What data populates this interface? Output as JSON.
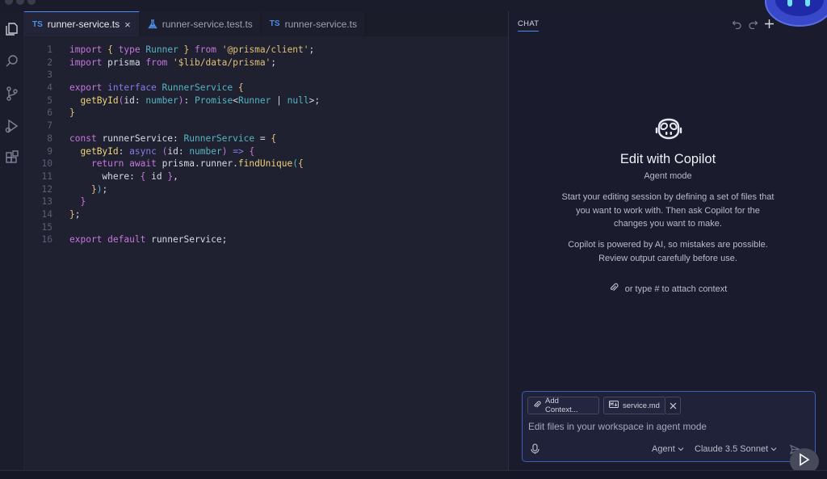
{
  "tabs": [
    {
      "lang": "TS",
      "name": "runner-service.ts",
      "active": true,
      "close": "×"
    },
    {
      "name": "runner-service.test.ts",
      "active": false
    },
    {
      "lang": "TS",
      "name": "runner-service.ts",
      "active": false
    }
  ],
  "code": {
    "line_numbers": [
      "1",
      "2",
      "3",
      "4",
      "5",
      "6",
      "7",
      "8",
      "9",
      "10",
      "11",
      "12",
      "13",
      "14",
      "15",
      "16"
    ]
  },
  "chat": {
    "tab_label": "CHAT",
    "title": "Edit with Copilot",
    "mode": "Agent mode",
    "description": "Start your editing session by defining a set of files that you want to work with. Then ask Copilot for the changes you want to make.",
    "disclaimer": "Copilot is powered by AI, so mistakes are possible. Review output carefully before use.",
    "attach_hint": "or type # to attach context",
    "input": {
      "add_context_label": "Add Context...",
      "file_chip_label": "service.md",
      "placeholder": "Edit files in your workspace in agent mode",
      "mode_dropdown": "Agent",
      "model_dropdown": "Claude 3.5 Sonnet"
    }
  },
  "icons": {
    "activity": [
      "explorer-icon",
      "search-icon",
      "source-control-icon",
      "run-debug-icon",
      "extensions-icon"
    ],
    "header": [
      "undo-icon",
      "redo-icon",
      "new-chat-icon"
    ]
  },
  "colors": {
    "accent": "#4b8cf0",
    "ts_badge": "#4a8fe8",
    "keyword": "#c678dd",
    "type": "#56b6c2",
    "string": "#e0c275"
  }
}
